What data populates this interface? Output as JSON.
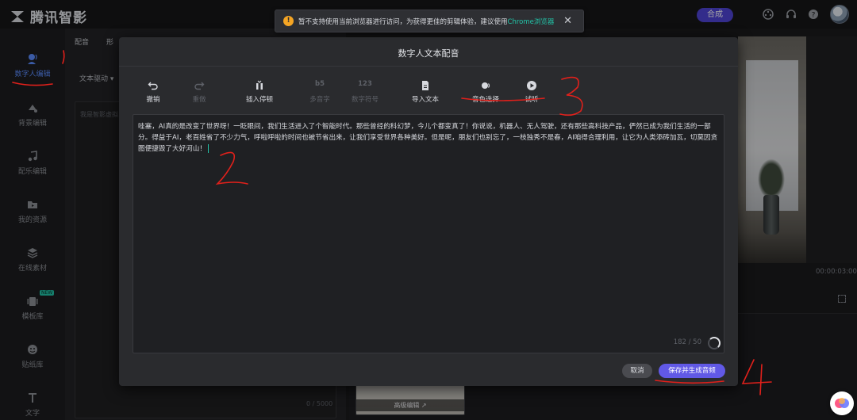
{
  "app": {
    "brand_name": "腾讯智影",
    "export_label": "合成"
  },
  "toast": {
    "message": "暂不支持使用当前浏览器进行访问，为获得更佳的剪辑体验，建议使用",
    "link": "Chrome浏览器",
    "warn_icon": "warning-icon",
    "close_icon": "close-icon"
  },
  "sidebar": {
    "items": [
      {
        "label": "数字人编辑",
        "icon": "digital-human-icon",
        "active": true
      },
      {
        "label": "背景编辑",
        "icon": "background-icon"
      },
      {
        "label": "配乐编辑",
        "icon": "music-note-icon"
      },
      {
        "label": "我的资源",
        "icon": "folder-icon"
      },
      {
        "label": "在线素材",
        "icon": "layers-icon"
      },
      {
        "label": "模板库",
        "icon": "template-icon",
        "badge": "NEW"
      },
      {
        "label": "贴纸库",
        "icon": "sticker-icon"
      },
      {
        "label": "文字",
        "icon": "text-icon"
      }
    ]
  },
  "panel2": {
    "tabs": [
      "配音",
      "形"
    ],
    "select_label": "文本驱动",
    "placeholder": "我是智影虚拟",
    "count": "0 / 5000"
  },
  "preview": {
    "time": "00:00:03:00",
    "thumb_label": "高级编辑 ↗"
  },
  "modal": {
    "title": "数字人文本配音",
    "tools": [
      {
        "label": "撤销",
        "icon": "undo-icon",
        "enabled": true
      },
      {
        "label": "重做",
        "icon": "redo-icon",
        "enabled": false
      },
      {
        "label": "插入停顿",
        "icon": "insert-pause-icon",
        "enabled": true
      },
      {
        "label": "多音字",
        "icon": "polyphone-icon",
        "icon_text": "b5",
        "enabled": false
      },
      {
        "label": "数字符号",
        "icon": "number-symbol-icon",
        "icon_text": "123",
        "enabled": false
      },
      {
        "label": "导入文本",
        "icon": "import-text-icon",
        "enabled": true
      },
      {
        "label": "音色选择",
        "icon": "voice-select-icon",
        "enabled": true
      },
      {
        "label": "试听",
        "icon": "play-icon",
        "enabled": true
      }
    ],
    "text": "哇塞，AI真的是改变了世界呀！一眨眼间，我们生活进入了个智能时代。那些曾经的科幻梦，今儿个都变真了！你说说，机器人、无人驾驶，还有那些高科技产品，俨然已成为我们生活的一部分。得益于AI，老百姓省了不少力气，呼啦呼啦的时间也被节省出来，让我们享受世界各种美好。但是呢，朋友们也别忘了，一枝独秀不是春，AI咱得合理利用，让它为人类添砖加瓦，切莫因贪图便捷毁了大好河山！",
    "char_count": "182 / 50",
    "cancel_label": "取消",
    "save_label": "保存并生成音频"
  },
  "annotations": {
    "color": "#e0201b",
    "labels": [
      "1",
      "2",
      "3",
      "4"
    ]
  }
}
